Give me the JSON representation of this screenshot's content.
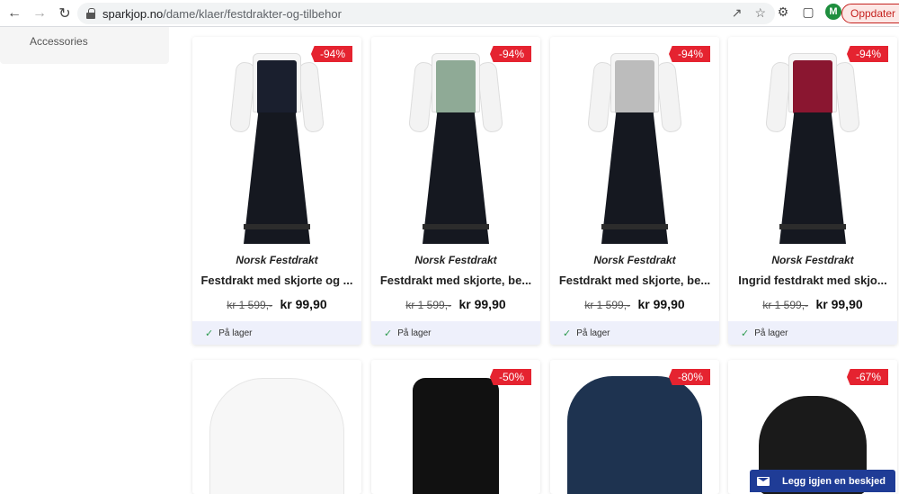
{
  "browser": {
    "url_host": "sparkjop.no",
    "url_path": "/dame/klaer/festdrakter-og-tilbehor",
    "profile_initial": "M",
    "update_label": "Oppdater"
  },
  "sidebar": {
    "items": [
      {
        "label": "Accessories"
      }
    ]
  },
  "products": [
    {
      "brand": "Norsk Festdrakt",
      "title": "Festdrakt med skjorte og ...",
      "old_price": "kr 1 599,-",
      "price": "kr 99,90",
      "discount": "-94%",
      "stock": "På lager",
      "bodice_color": "#1a1f2e"
    },
    {
      "brand": "Norsk Festdrakt",
      "title": "Festdrakt med skjorte, be...",
      "old_price": "kr 1 599,-",
      "price": "kr 99,90",
      "discount": "-94%",
      "stock": "På lager",
      "bodice_color": "#8faa96"
    },
    {
      "brand": "Norsk Festdrakt",
      "title": "Festdrakt med skjorte, be...",
      "old_price": "kr 1 599,-",
      "price": "kr 99,90",
      "discount": "-94%",
      "stock": "På lager",
      "bodice_color": "#bcbcbc"
    },
    {
      "brand": "Norsk Festdrakt",
      "title": "Ingrid festdrakt med skjo...",
      "old_price": "kr 1 599,-",
      "price": "kr 99,90",
      "discount": "-94%",
      "stock": "På lager",
      "bodice_color": "#8a1630"
    }
  ],
  "products_row2": [
    {
      "discount": ""
    },
    {
      "discount": "-50%"
    },
    {
      "discount": "-80%"
    },
    {
      "discount": "-67%"
    }
  ],
  "chat": {
    "label": "Legg igjen en beskjed"
  },
  "colors": {
    "badge": "#e52330",
    "stock_bg": "#eef0fb",
    "chat_bg": "#1f3c96"
  }
}
